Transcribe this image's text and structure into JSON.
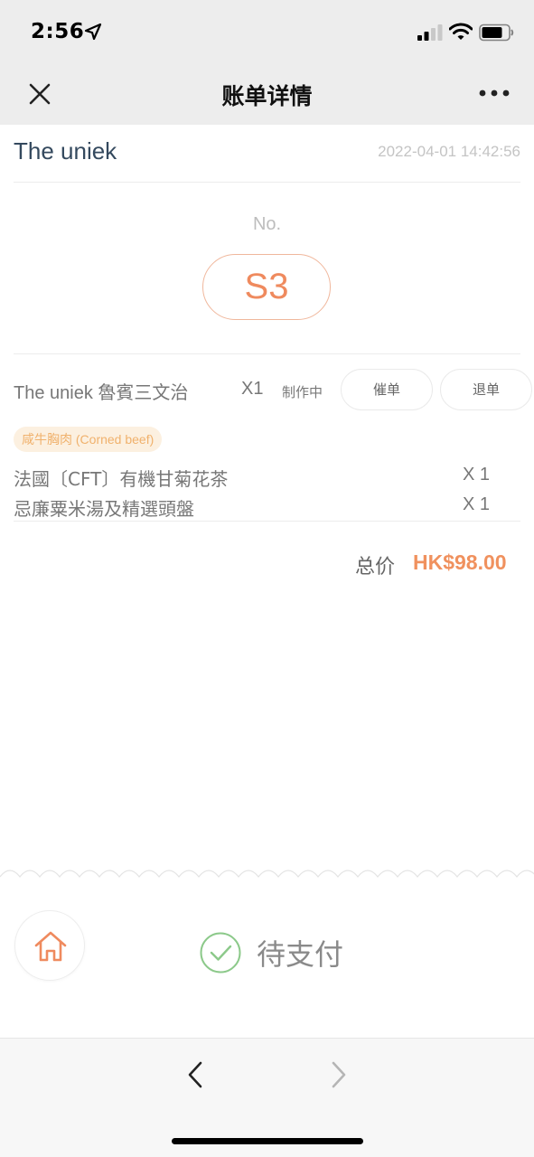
{
  "status_bar": {
    "time": "2:56"
  },
  "nav": {
    "title": "账单详情"
  },
  "order": {
    "store_name": "The uniek",
    "datetime": "2022-04-01 14:42:56",
    "number_label": "No.",
    "number": "S3"
  },
  "items": [
    {
      "name": "The uniek 魯賓三文治",
      "quantity": "X1",
      "status": "制作中",
      "urge_label": "催单",
      "refund_label": "退单",
      "option_tag": "咸牛胸肉 (Corned beef)",
      "sub_items": [
        {
          "name": "法國〔CFT〕有機甘菊花茶",
          "quantity": "X 1"
        },
        {
          "name": "忌廉粟米湯及精選頭盤",
          "quantity": "X 1"
        }
      ]
    }
  ],
  "total": {
    "label": "总价",
    "value": "HK$98.00"
  },
  "payment": {
    "status": "待支付"
  },
  "colors": {
    "accent": "#ef8a5e",
    "check": "#8cc98a",
    "tag_bg": "#fcf0e0",
    "tag_text": "#f0b16c"
  }
}
